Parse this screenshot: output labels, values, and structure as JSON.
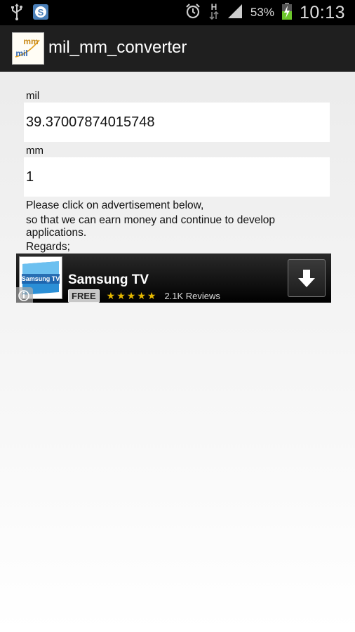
{
  "statusbar": {
    "left_icons": [
      "usb-icon",
      "skype-icon"
    ],
    "right_icons": [
      "alarm-icon",
      "h-data-icon",
      "signal-icon",
      "battery-charging-icon"
    ],
    "battery_percent": "53%",
    "clock": "10:13"
  },
  "actionbar": {
    "app_icon_text_top": "mm",
    "app_icon_text_bottom": "mil",
    "title": "mil_mm_converter"
  },
  "form": {
    "mil_label": "mil",
    "mil_value": "39.37007874015748",
    "mm_label": "mm",
    "mm_value": "1"
  },
  "message": {
    "line1": "Please click on advertisement below,",
    "line2": "so that we can earn money and continue to develop applications.",
    "line3": "Regards;"
  },
  "ad": {
    "thumb_label": "Samsung TV",
    "title": "Samsung TV",
    "badge": "FREE",
    "stars": "★★★★★",
    "reviews": "2.1K Reviews",
    "download_icon": "download-arrow-icon",
    "info_icon": "info-icon"
  },
  "colors": {
    "statusbar_bg": "#000000",
    "actionbar_bg": "#1f1f1f",
    "ad_bg": "#111111",
    "star": "#e5b800"
  }
}
